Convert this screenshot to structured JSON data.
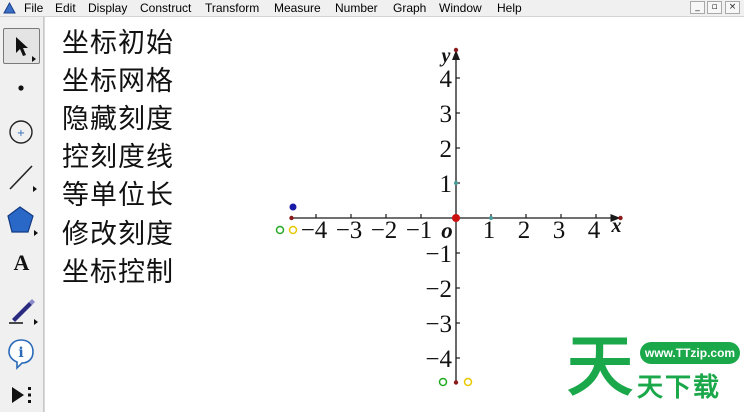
{
  "menubar": {
    "items": [
      {
        "label": "File",
        "key": "file"
      },
      {
        "label": "Edit",
        "key": "edit"
      },
      {
        "label": "Display",
        "key": "display"
      },
      {
        "label": "Construct",
        "key": "construct"
      },
      {
        "label": "Transform",
        "key": "transform"
      },
      {
        "label": "Measure",
        "key": "measure"
      },
      {
        "label": "Number",
        "key": "number"
      },
      {
        "label": "Graph",
        "key": "graph"
      },
      {
        "label": "Window",
        "key": "window"
      },
      {
        "label": "Help",
        "key": "help"
      }
    ],
    "window_buttons": [
      "_",
      "▫",
      "×"
    ]
  },
  "toolbox": {
    "tools": [
      {
        "name": "arrow-select-tool",
        "icon": "arrow-icon",
        "active": true
      },
      {
        "name": "point-tool",
        "icon": "point-icon",
        "active": false
      },
      {
        "name": "compass-tool",
        "icon": "circle-icon",
        "active": false
      },
      {
        "name": "straightedge-tool",
        "icon": "line-segment-icon",
        "active": false
      },
      {
        "name": "polygon-tool",
        "icon": "pentagon-icon",
        "active": false
      },
      {
        "name": "text-tool",
        "icon": "text-a-icon",
        "label": "A",
        "active": false
      },
      {
        "name": "marker-tool",
        "icon": "pen-icon",
        "active": false
      },
      {
        "name": "information-tool",
        "icon": "info-icon",
        "active": false
      },
      {
        "name": "custom-tool",
        "icon": "play-menu-icon",
        "active": false
      }
    ]
  },
  "commands": [
    "坐标初始",
    "坐标网格",
    "隐藏刻度",
    "控刻度线",
    "等单位长",
    "修改刻度",
    "坐标控制"
  ],
  "graph": {
    "x_axis_label": "x",
    "y_axis_label": "y",
    "origin_label": "o",
    "x_tick_labels": [
      "−4",
      "−3",
      "−2",
      "−1",
      "1",
      "2",
      "3",
      "4"
    ],
    "x_tick_values": [
      -4,
      -3,
      -2,
      -1,
      1,
      2,
      3,
      4
    ],
    "y_tick_labels": [
      "4",
      "3",
      "2",
      "1",
      "−1",
      "−2",
      "−3",
      "−4"
    ],
    "y_tick_values": [
      4,
      3,
      2,
      1,
      -1,
      -2,
      -3,
      -4
    ],
    "x_range": [
      -4.7,
      4.7
    ],
    "y_range": [
      -4.7,
      4.8
    ],
    "colors": {
      "axis": "#1a1a1a",
      "origin_point": "#cc1111",
      "control_green": "#22aa22",
      "control_yellow": "#e8c800",
      "control_blue": "#1a1aa8",
      "end_point": "#8b1a1a",
      "unit_point": "#4a9a9a"
    }
  },
  "watermark": {
    "url": "www.TTzip.com",
    "big": "天",
    "small": "天下载"
  }
}
